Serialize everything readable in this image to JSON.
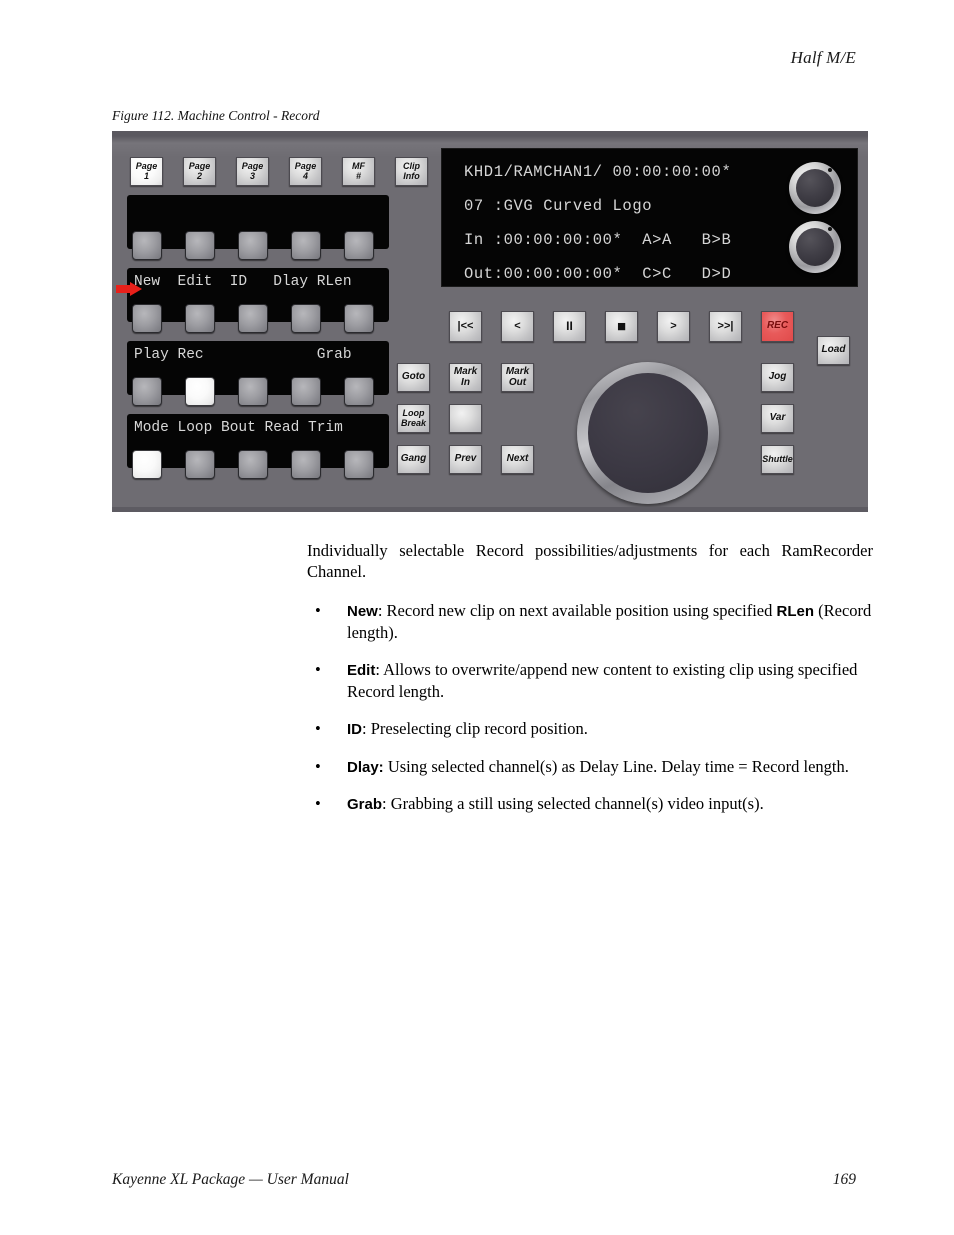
{
  "header": {
    "running_head": "Half M/E"
  },
  "footer": {
    "left": "Kayenne XL Package  —  User Manual",
    "page_number": "169"
  },
  "figure": {
    "caption": "Figure 112.  Machine Control - Record",
    "panel": {
      "top_buttons": [
        {
          "name": "page-1",
          "line1": "Page",
          "line2": "1",
          "lit": true
        },
        {
          "name": "page-2",
          "line1": "Page",
          "line2": "2",
          "lit": false
        },
        {
          "name": "page-3",
          "line1": "Page",
          "line2": "3",
          "lit": false
        },
        {
          "name": "page-4",
          "line1": "Page",
          "line2": "4",
          "lit": false
        },
        {
          "name": "mf-number",
          "line1": "MF",
          "line2": "#",
          "lit": false
        },
        {
          "name": "clip-info",
          "line1": "Clip",
          "line2": "Info",
          "lit": false
        }
      ],
      "label_strips": [
        {
          "name": "strip-row-1",
          "text": ""
        },
        {
          "name": "strip-row-2",
          "text": "New  Edit  ID   Dlay RLen"
        },
        {
          "name": "strip-row-3",
          "text": "Play Rec             Grab"
        },
        {
          "name": "strip-row-4",
          "text": "Mode Loop Bout Read Trim"
        }
      ],
      "soft_key_rows": [
        {
          "row": 1,
          "lit_index": -1
        },
        {
          "row": 2,
          "lit_index": -1
        },
        {
          "row": 3,
          "lit_index": 1
        },
        {
          "row": 4,
          "lit_index": 0
        }
      ],
      "display": {
        "line1": "KHD1/RAMCHAN1/ 00:00:00:00*",
        "line2": "07 :GVG Curved Logo",
        "line3": "In :00:00:00:00*  A>A   B>B",
        "line4": "Out:00:00:00:00*  C>C   D>D"
      },
      "transport_buttons": [
        {
          "name": "rewind-to-start-button",
          "label": "|<<",
          "kind": "sym"
        },
        {
          "name": "rewind-button",
          "label": "<",
          "kind": "sym"
        },
        {
          "name": "pause-button",
          "label": "II",
          "kind": "sym"
        },
        {
          "name": "stop-button",
          "label": "■",
          "kind": "sym"
        },
        {
          "name": "play-button",
          "label": ">",
          "kind": "sym"
        },
        {
          "name": "fast-forward-button",
          "label": ">>|",
          "kind": "sym"
        },
        {
          "name": "record-button",
          "label": "REC",
          "kind": "rec"
        }
      ],
      "load_button": {
        "name": "load-button",
        "label": "Load"
      },
      "left_function_buttons": [
        {
          "name": "goto-button",
          "line1": "Goto",
          "line2": ""
        },
        {
          "name": "mark-in-button",
          "line1": "Mark",
          "line2": "In"
        },
        {
          "name": "mark-out-button",
          "line1": "Mark",
          "line2": "Out"
        },
        {
          "name": "loop-break-button",
          "line1": "Loop",
          "line2": "Break"
        },
        {
          "name": "unlabeled-button",
          "line1": "",
          "line2": ""
        },
        {
          "name": "gang-button",
          "line1": "Gang",
          "line2": ""
        },
        {
          "name": "prev-button",
          "line1": "Prev",
          "line2": ""
        },
        {
          "name": "next-button",
          "line1": "Next",
          "line2": ""
        }
      ],
      "right_function_buttons": [
        {
          "name": "jog-button",
          "label": "Jog"
        },
        {
          "name": "var-button",
          "label": "Var"
        },
        {
          "name": "shuttle-button",
          "label": "Shuttle"
        }
      ]
    }
  },
  "body": {
    "intro": "Individually selectable Record possibilities/adjustments for each RamRecorder Channel.",
    "bullets": [
      {
        "term": "New",
        "rest_a": ": Record new clip on next available position using specified ",
        "term_b": "RLen",
        "rest_b": " (Record length)."
      },
      {
        "term": "Edit",
        "rest_a": ": Allows to overwrite/append new content to existing clip using specified Record length.",
        "term_b": "",
        "rest_b": ""
      },
      {
        "term": "ID",
        "rest_a": ": Preselecting clip record position.",
        "term_b": "",
        "rest_b": ""
      },
      {
        "term": "Dlay:",
        "rest_a": " Using selected channel(s) as Delay Line. Delay time = Record length.",
        "term_b": "",
        "rest_b": ""
      },
      {
        "term": "Grab",
        "rest_a": ": Grabbing a still using selected channel(s) video input(s).",
        "term_b": "",
        "rest_b": ""
      }
    ]
  },
  "colors": {
    "panel": "#6e6c72",
    "lcd": "#050505",
    "record_red": "#e85a5a",
    "pointer_red": "#e8201a"
  }
}
